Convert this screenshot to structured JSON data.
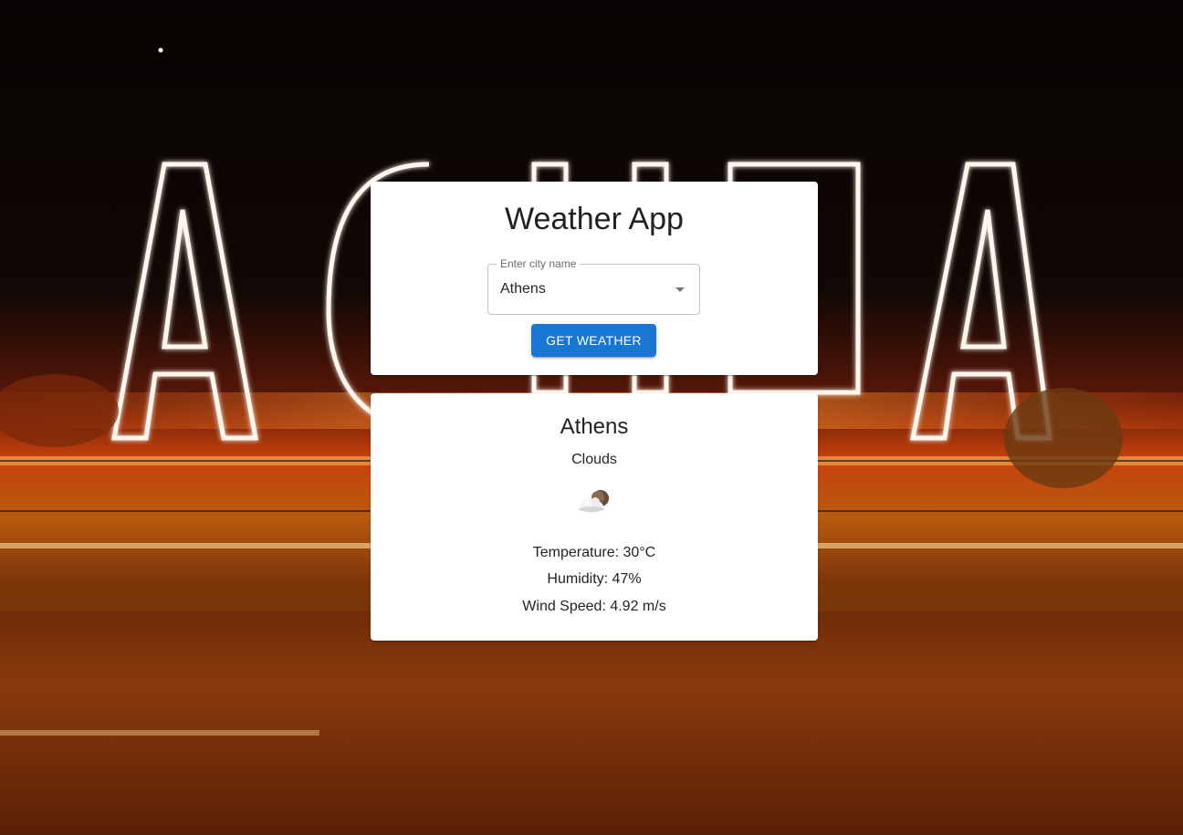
{
  "app": {
    "title": "Weather App"
  },
  "search": {
    "label": "Enter city name",
    "value": "Athens",
    "button_label": "GET WEATHER"
  },
  "result": {
    "city": "Athens",
    "condition": "Clouds",
    "icon": "cloud-moon-icon",
    "temperature": "Temperature: 30°C",
    "humidity": "Humidity: 47%",
    "wind_speed": "Wind Speed: 4.92 m/s"
  },
  "theme": {
    "primary": "#1976d2",
    "card_bg": "#ffffff"
  }
}
